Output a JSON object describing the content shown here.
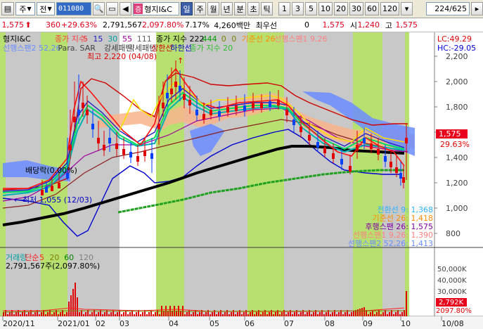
{
  "toolbar": {
    "market": "주",
    "prev_label": "전",
    "code": "011080",
    "name_badge": "증",
    "name": "형지I&C",
    "periods": [
      "일",
      "주",
      "월",
      "년",
      "분",
      "초",
      "틱"
    ],
    "active_period": "일",
    "intervals": [
      "1",
      "3",
      "5",
      "10",
      "20",
      "30",
      "60",
      "120"
    ],
    "count": "224/625"
  },
  "quote": {
    "price": "1,575",
    "change": "360",
    "change_pct": "+29.63%",
    "volume": "2,791,567",
    "volume_pct": "2,097.80%",
    "turnover_pct": "7.17%",
    "amount": "4,260백만",
    "broker_label": "최우선",
    "broker_value": "0",
    "ask": "1,575",
    "low_label": "시",
    "low_value": "1,240",
    "high_label": "고",
    "high_value": "1,575"
  },
  "chart_data": {
    "type": "line",
    "title_stock": "형지I&C",
    "legend_top": [
      {
        "text": "종가 지수",
        "color": "#ff3b3b"
      },
      {
        "text": "5",
        "color": "#ff2020"
      },
      {
        "text": "15",
        "color": "#2020c0"
      },
      {
        "text": "30",
        "color": "#00a0a0"
      },
      {
        "text": "55",
        "color": "#a000a0"
      },
      {
        "text": "111",
        "color": "#606060"
      },
      {
        "text": "종가 지수 222",
        "color": "#000000"
      },
      {
        "text": "444",
        "color": "#00a000"
      },
      {
        "text": "0",
        "color": "#808000"
      },
      {
        "text": "0",
        "color": "#808000"
      },
      {
        "text": "기준선 26",
        "color": "#ff8c00"
      },
      {
        "text": "선행스팬1 9,26",
        "color": "#ff8080"
      }
    ],
    "legend_second": [
      {
        "text": "선행스팬2 52,26",
        "color": "#6a8cff"
      },
      {
        "text": "Para. SAR",
        "color": "#404040"
      },
      {
        "text": "강세패턴",
        "color": "#404040"
      },
      {
        "text": "약세패턴",
        "color": "#404040"
      },
      {
        "text": "상한선",
        "color": "#d00000"
      },
      {
        "text": "하한선",
        "color": "#0000d0"
      },
      {
        "text": "종가 지수 20",
        "color": "#30c030"
      }
    ],
    "lc_label": "LC:49.29",
    "hc_label": "HC:-29.05",
    "y_ticks": [
      "2,200",
      "2,000",
      "1,800",
      "1,600",
      "1,400",
      "1,200",
      "1,000",
      "800"
    ],
    "ylim": [
      650,
      2300
    ],
    "x_ticks": [
      "2020/11",
      "2021/01",
      "02",
      "03",
      "04",
      "05",
      "06",
      "07",
      "08",
      "09",
      "10",
      "10/08"
    ],
    "current_price_tag": "1,575",
    "current_pct_tag": "29.63%",
    "annotations": {
      "high": "최고 2,220 (04/08)",
      "low": "최저 1,055 (12/03)",
      "dividend": "배당락(0.00%)"
    },
    "indicator_values": [
      {
        "text": "전환선 9: 1,368",
        "color": "#30b0ff"
      },
      {
        "text": "기준선 26: 1,418",
        "color": "#ff8c00"
      },
      {
        "text": "후행스팬 26: 1,575",
        "color": "#8000a0"
      },
      {
        "text": "선행스팬1 9,26: 1,390",
        "color": "#ff8080"
      },
      {
        "text": "선행스팬2 52,26: 1,413",
        "color": "#6a8cff"
      }
    ],
    "series": [
      {
        "name": "종가 지수 222",
        "values": [
          900,
          920,
          960,
          1020,
          1100,
          1180,
          1240,
          1280,
          1320,
          1360,
          1400,
          1440,
          1490,
          1500,
          1480,
          1440,
          1430
        ]
      },
      {
        "name": "종가 지수 444",
        "values": [
          920,
          960,
          1000,
          1040,
          1080,
          1120,
          1150,
          1180,
          1210,
          1240,
          1260,
          1280,
          1290
        ]
      }
    ],
    "volume_panel": {
      "legend": [
        {
          "text": "거래량",
          "color": "#00a0a0"
        },
        {
          "text": "단순",
          "color": "#ff2020"
        },
        {
          "text": "5",
          "color": "#ff2020"
        },
        {
          "text": "20",
          "color": "#808000"
        },
        {
          "text": "60",
          "color": "#008000"
        },
        {
          "text": "120",
          "color": "#808080"
        }
      ],
      "value_label": "2,791,567주(2,097.80%)",
      "y_ticks": [
        "50,000K",
        "40,000K",
        "30,000K",
        "20,000K",
        "10,000K"
      ],
      "current_tag": "2,792K",
      "current_pct": "2097.80%"
    }
  }
}
